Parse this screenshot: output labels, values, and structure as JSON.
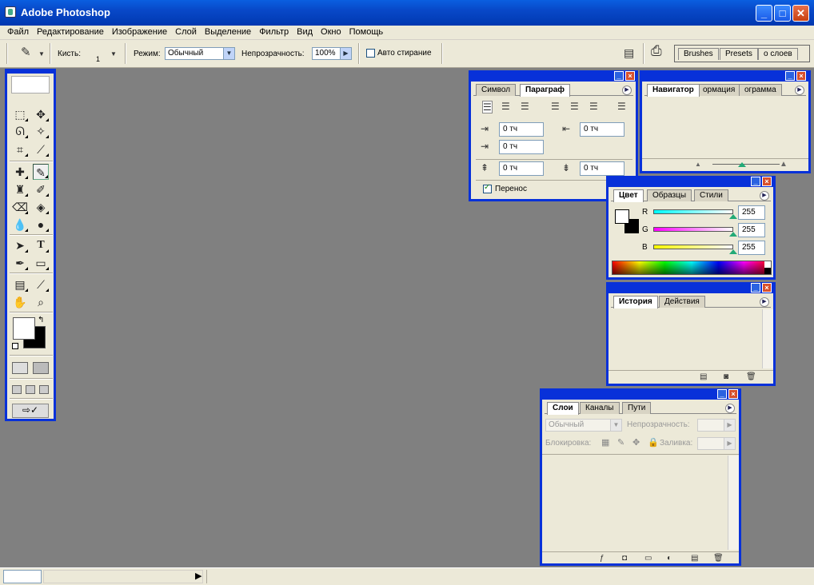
{
  "window": {
    "title": "Adobe Photoshop",
    "minimize": "_",
    "maximize": "□",
    "close": "✕"
  },
  "menu": [
    "Файл",
    "Редактирование",
    "Изображение",
    "Слой",
    "Выделение",
    "Фильтр",
    "Вид",
    "Окно",
    "Помощь"
  ],
  "options": {
    "brush_label": "Кисть:",
    "brush_size": "1",
    "mode_label": "Режим:",
    "mode_value": "Обычный",
    "opacity_label": "Непрозрачность:",
    "opacity_value": "100%",
    "auto_erase_label": "Авто стирание",
    "auto_erase_checked": false
  },
  "well_tabs": [
    "Brushes",
    "Presets",
    "о слоев"
  ],
  "paragraph_palette": {
    "tabs": [
      "Символ",
      "Параграф"
    ],
    "active_tab": "Параграф",
    "fields": {
      "indent_left": "0 тч",
      "indent_right": "0 тч",
      "indent_first": "0 тч",
      "space_before": "0 тч",
      "space_after": "0 тч"
    },
    "hyphenate_label": "Перенос",
    "hyphenate_checked": true
  },
  "navigator_palette": {
    "tabs": [
      "Навигатор",
      "ормация",
      "ограмма"
    ],
    "active_tab": "Навигатор"
  },
  "color_palette": {
    "tabs": [
      "Цвет",
      "Образцы",
      "Стили"
    ],
    "active_tab": "Цвет",
    "channels": [
      {
        "name": "R",
        "value": "255"
      },
      {
        "name": "G",
        "value": "255"
      },
      {
        "name": "B",
        "value": "255"
      }
    ]
  },
  "history_palette": {
    "tabs": [
      "История",
      "Действия"
    ],
    "active_tab": "История"
  },
  "layers_palette": {
    "tabs": [
      "Слои",
      "Каналы",
      "Пути"
    ],
    "active_tab": "Слои",
    "blend_mode": "Обычный",
    "opacity_label": "Непрозрачность:",
    "lock_label": "Блокировка:",
    "fill_label": "Заливка:"
  },
  "status_bar": {
    "arrow": "▶"
  }
}
